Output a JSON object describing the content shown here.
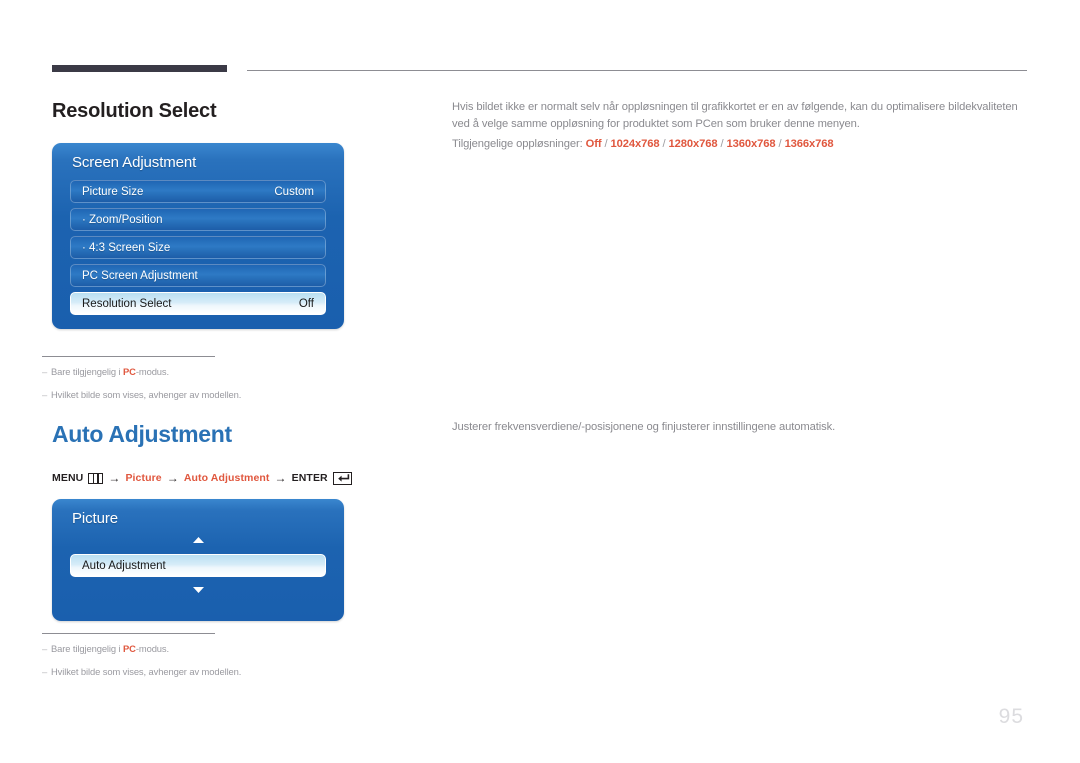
{
  "page": {
    "number": "95"
  },
  "sections": [
    {
      "heading": "Resolution Select",
      "panel": {
        "title": "Screen Adjustment",
        "rows": [
          {
            "label": "Picture Size",
            "value": "Custom",
            "selected": false
          },
          {
            "label": "· Zoom/Position",
            "value": "",
            "selected": false
          },
          {
            "label": "· 4:3 Screen Size",
            "value": "",
            "selected": false
          },
          {
            "label": "PC Screen Adjustment",
            "value": "",
            "selected": false
          },
          {
            "label": "Resolution Select",
            "value": "Off",
            "selected": true
          }
        ]
      },
      "description": "Hvis bildet ikke er normalt selv når oppløsningen til grafikkortet er en av følgende, kan du optimalisere bildekvaliteten ved å velge samme oppløsning for produktet som PCen som bruker denne menyen.",
      "available_label": "Tilgjengelige oppløsninger:",
      "available_values": [
        "Off",
        "1024x768",
        "1280x768",
        "1360x768",
        "1366x768"
      ],
      "footnotes": [
        {
          "pre": "Bare tilgjengelig i ",
          "bold": "PC",
          "post": "-modus."
        },
        {
          "pre": "Hvilket bilde som vises, avhenger av modellen.",
          "bold": "",
          "post": ""
        }
      ]
    },
    {
      "heading": "Auto Adjustment",
      "breadcrumb": {
        "menu_label": "MENU",
        "menu_icon": "menu-grid-icon",
        "items": [
          "Picture",
          "Auto Adjustment"
        ],
        "enter_label": "ENTER",
        "enter_icon": "enter-return-icon",
        "arrow": "→"
      },
      "panel": {
        "title": "Picture",
        "up_arrow_icon": "chevron-up-icon",
        "down_arrow_icon": "chevron-down-icon",
        "rows": [
          {
            "label": "Auto Adjustment",
            "value": "",
            "selected": true
          }
        ]
      },
      "description": "Justerer frekvensverdiene/-posisjonene og finjusterer innstillingene automatisk.",
      "footnotes": [
        {
          "pre": "Bare tilgjengelig i ",
          "bold": "PC",
          "post": "-modus."
        },
        {
          "pre": "Hvilket bilde som vises, avhenger av modellen.",
          "bold": "",
          "post": ""
        }
      ]
    }
  ],
  "colors": {
    "accent": "#e0573e",
    "heading_blue": "#2a72b5",
    "panel_blue": "#1c63b0",
    "rule_dark": "#3b3a46"
  }
}
